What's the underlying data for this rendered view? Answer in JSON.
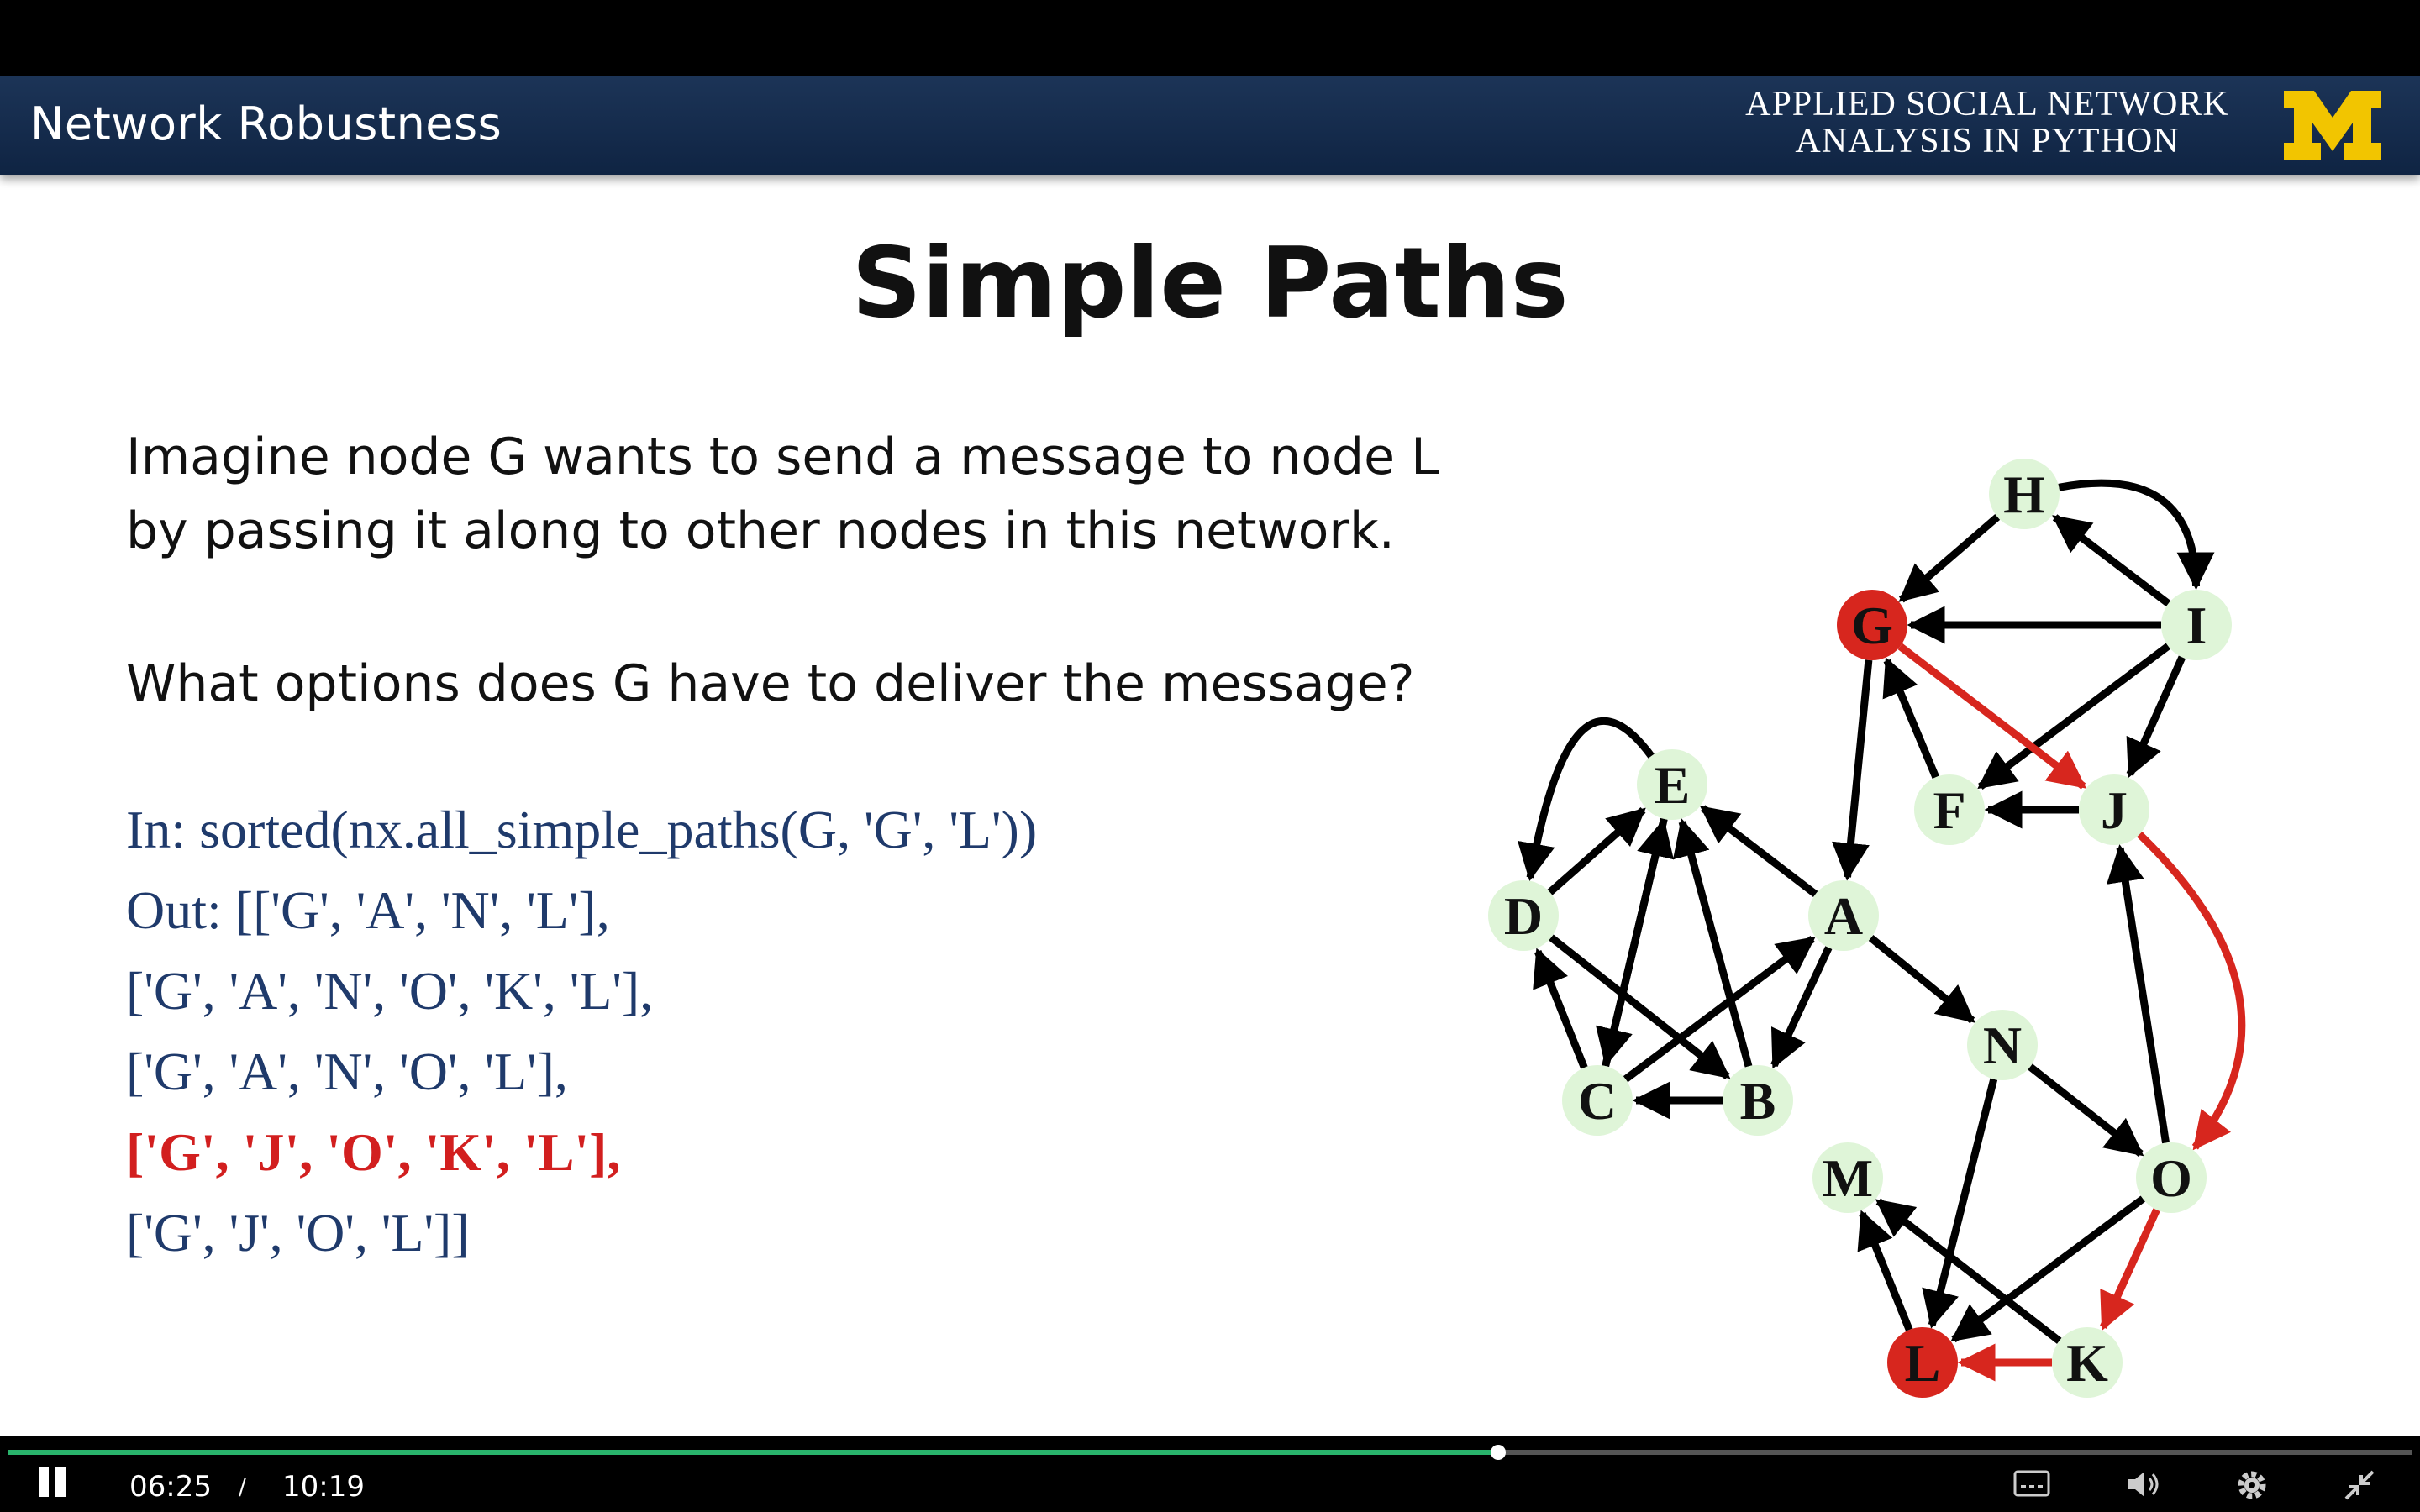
{
  "header": {
    "lecture_title": "Network Robustness",
    "course_title_line1": "APPLIED SOCIAL NETWORK",
    "course_title_line2": "ANALYSIS IN PYTHON",
    "logo_letter": "M",
    "logo_color": "#f2c500"
  },
  "slide": {
    "heading": "Simple Paths",
    "body_line1": "Imagine node G wants to send a message to node L",
    "body_line2": "by passing it along to other nodes in this network.",
    "question": "What options does G have to deliver the message?",
    "code": {
      "input": "In: sorted(nx.all_simple_paths(G, 'G', 'L'))",
      "out_line1": "Out: [['G', 'A', 'N', 'L'],",
      "out_line2": "['G', 'A', 'N', 'O', 'K', 'L'],",
      "out_line3": "['G', 'A', 'N', 'O', 'L'],",
      "out_line4": "['G', 'J', 'O', 'K', 'L'],",
      "out_line5": "['G', 'J', 'O', 'L']]"
    }
  },
  "graph": {
    "nodes": [
      {
        "id": "H",
        "color": "#dff5d8"
      },
      {
        "id": "G",
        "color": "#d7261e"
      },
      {
        "id": "I",
        "color": "#dff5d8"
      },
      {
        "id": "E",
        "color": "#dff5d8"
      },
      {
        "id": "F",
        "color": "#dff5d8"
      },
      {
        "id": "J",
        "color": "#dff5d8"
      },
      {
        "id": "D",
        "color": "#dff5d8"
      },
      {
        "id": "A",
        "color": "#dff5d8"
      },
      {
        "id": "N",
        "color": "#dff5d8"
      },
      {
        "id": "C",
        "color": "#dff5d8"
      },
      {
        "id": "B",
        "color": "#dff5d8"
      },
      {
        "id": "M",
        "color": "#dff5d8"
      },
      {
        "id": "O",
        "color": "#dff5d8"
      },
      {
        "id": "L",
        "color": "#d7261e"
      },
      {
        "id": "K",
        "color": "#dff5d8"
      }
    ],
    "edges": [
      {
        "from": "H",
        "to": "G",
        "highlight": false
      },
      {
        "from": "H",
        "to": "I",
        "highlight": false
      },
      {
        "from": "I",
        "to": "H",
        "highlight": false
      },
      {
        "from": "I",
        "to": "G",
        "highlight": false
      },
      {
        "from": "I",
        "to": "F",
        "highlight": false
      },
      {
        "from": "I",
        "to": "J",
        "highlight": false
      },
      {
        "from": "G",
        "to": "J",
        "highlight": true
      },
      {
        "from": "G",
        "to": "A",
        "highlight": false
      },
      {
        "from": "F",
        "to": "G",
        "highlight": false
      },
      {
        "from": "J",
        "to": "F",
        "highlight": false
      },
      {
        "from": "J",
        "to": "O",
        "highlight": true
      },
      {
        "from": "E",
        "to": "D",
        "highlight": false
      },
      {
        "from": "D",
        "to": "E",
        "highlight": false
      },
      {
        "from": "D",
        "to": "B",
        "highlight": false
      },
      {
        "from": "A",
        "to": "E",
        "highlight": false
      },
      {
        "from": "A",
        "to": "B",
        "highlight": false
      },
      {
        "from": "A",
        "to": "N",
        "highlight": false
      },
      {
        "from": "E",
        "to": "C",
        "highlight": false
      },
      {
        "from": "C",
        "to": "E",
        "highlight": false
      },
      {
        "from": "C",
        "to": "D",
        "highlight": false
      },
      {
        "from": "C",
        "to": "A",
        "highlight": false
      },
      {
        "from": "B",
        "to": "C",
        "highlight": false
      },
      {
        "from": "B",
        "to": "E",
        "highlight": false
      },
      {
        "from": "N",
        "to": "O",
        "highlight": false
      },
      {
        "from": "N",
        "to": "L",
        "highlight": false
      },
      {
        "from": "O",
        "to": "J",
        "highlight": false
      },
      {
        "from": "O",
        "to": "L",
        "highlight": false
      },
      {
        "from": "O",
        "to": "K",
        "highlight": true
      },
      {
        "from": "K",
        "to": "M",
        "highlight": false
      },
      {
        "from": "K",
        "to": "L",
        "highlight": true
      },
      {
        "from": "L",
        "to": "M",
        "highlight": false
      }
    ],
    "edge_color": "#000000",
    "highlight_color": "#d7261e"
  },
  "player": {
    "current_time": "06:25",
    "separator": "/",
    "duration": "10:19",
    "progress": 0.62,
    "progress_color": "#29b36b",
    "icons": [
      "pause-icon",
      "captions-icon",
      "volume-icon",
      "settings-icon",
      "exit-fullscreen-icon"
    ]
  }
}
